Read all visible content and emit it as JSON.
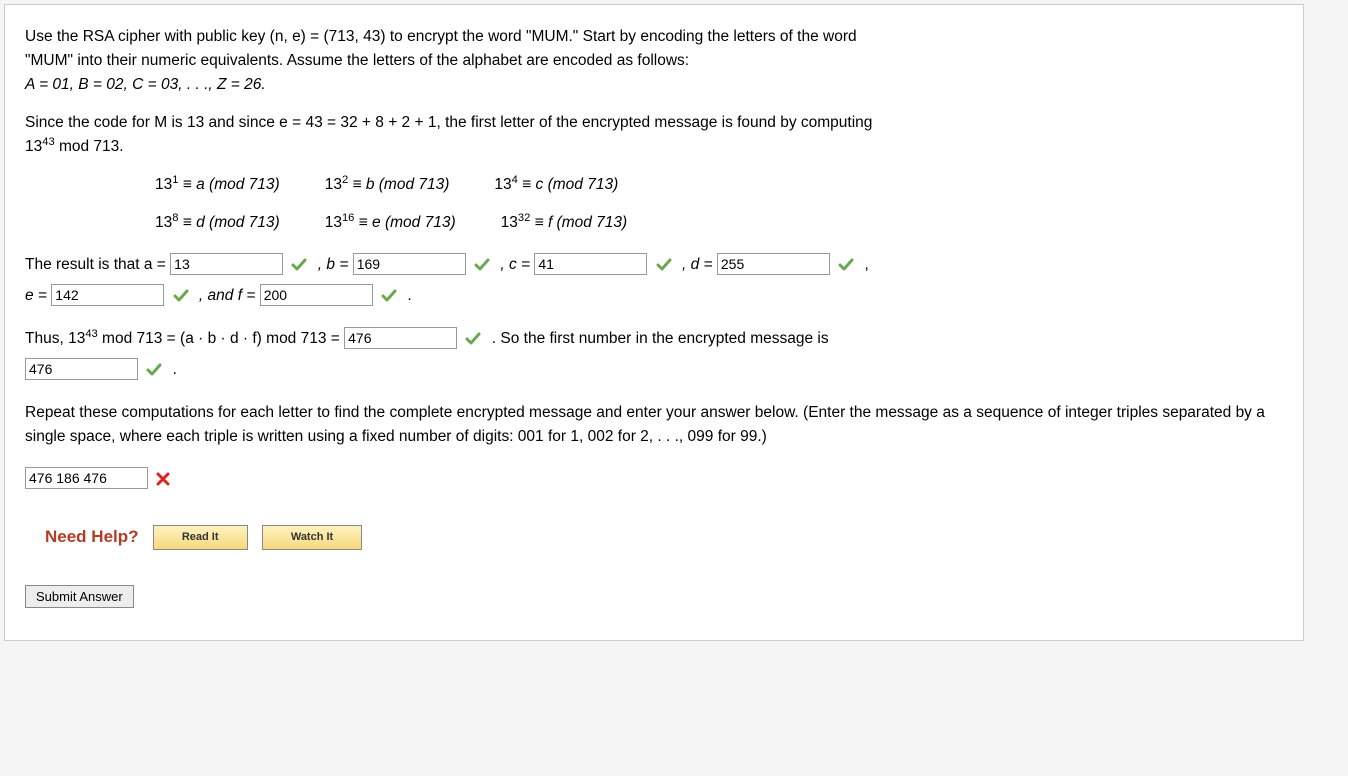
{
  "intro_line1": "Use the RSA cipher with public key (n, e) = (713, 43) to encrypt the word \"MUM.\" Start by encoding the letters of the word",
  "intro_line2": "\"MUM\" into their numeric equivalents. Assume the letters of the alphabet are encoded as follows:",
  "intro_line3": "A = 01, B = 02, C = 03, . . ., Z = 26.",
  "since_line1": "Since the code for M is 13 and since e = 43 = 32 + 8 + 2 + 1, the first letter of the encrypted message is found by computing",
  "since_line2_pre": "13",
  "since_line2_sup": "43",
  "since_line2_post": " mod 713.",
  "eq_row1": {
    "a_base": "13",
    "a_exp": "1",
    "a_rhs": " ≡ a (mod 713)",
    "b_base": "13",
    "b_exp": "2",
    "b_rhs": "  ≡ b (mod 713)",
    "c_base": "13",
    "c_exp": "4",
    "c_rhs": "  ≡ c (mod 713)"
  },
  "eq_row2": {
    "d_base": "13",
    "d_exp": "8",
    "d_rhs": " ≡ d (mod 713)",
    "e_base": "13",
    "e_exp": "16",
    "e_rhs": " ≡ e (mod 713)",
    "f_base": "13",
    "f_exp": "32",
    "f_rhs": " ≡ f (mod 713)"
  },
  "result_lead": "The result is that a = ",
  "a_val": "13",
  "b_lead": " ,  b = ",
  "b_val": "169",
  "c_lead": " ,  c = ",
  "c_val": "41",
  "d_lead": " ,  d = ",
  "d_val": "255",
  "d_trail": " ,",
  "e_lead": "e = ",
  "e_val": "142",
  "f_lead": " ,  and f = ",
  "f_val": "200",
  "f_trail": " .",
  "thus_lead": "Thus, 13",
  "thus_sup": "43",
  "thus_mid": " mod 713 = (a · b · d · f) mod 713 = ",
  "thus_val": "476",
  "thus_trail": " .  So the first number in the encrypted message is",
  "ans_first": "476",
  "ans_trail": " .",
  "repeat_p1": "Repeat these computations for each letter to find the complete encrypted message and enter your answer below. (Enter the message as a sequence of integer triples separated by a single space, where each triple is written using a fixed number of digits: 001 for 1, 002 for 2, . . ., 099 for 99.)",
  "final_ans": "476 186 476",
  "need_help": "Need Help?",
  "read_it": "Read It",
  "watch_it": "Watch It",
  "submit": "Submit Answer"
}
